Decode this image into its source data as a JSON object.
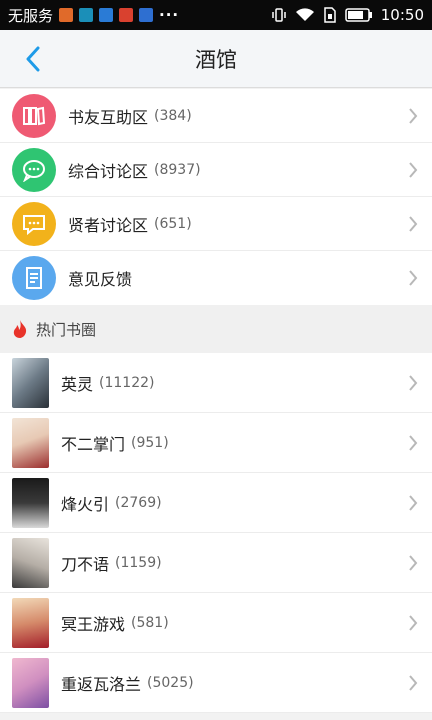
{
  "statusbar": {
    "carrier": "无服务",
    "time": "10:50",
    "more": "···",
    "app_icon_colors": [
      "#e06a2a",
      "#1b8fb8",
      "#2a7bd6",
      "#d9412f",
      "#2e6fd1"
    ]
  },
  "header": {
    "title": "酒馆",
    "back_icon": "chevron-left-icon"
  },
  "forums": [
    {
      "name": "书友互助区",
      "count": "(384)",
      "color": "#ef5a73",
      "icon": "books-icon"
    },
    {
      "name": "综合讨论区",
      "count": "(8937)",
      "color": "#2fc572",
      "icon": "chat-bubble-icon"
    },
    {
      "name": "贤者讨论区",
      "count": "(651)",
      "color": "#f2b21b",
      "icon": "message-icon"
    },
    {
      "name": "意见反馈",
      "count": "",
      "color": "#5aa8ee",
      "icon": "document-icon"
    }
  ],
  "hot_section": {
    "label": "热门书圈",
    "icon": "flame-icon"
  },
  "circles": [
    {
      "name": "英灵",
      "count": "(11122)",
      "cover_colors": [
        "#6c7a86",
        "#c9d4dc"
      ]
    },
    {
      "name": "不二掌门",
      "count": "(951)",
      "cover_colors": [
        "#e7c9b4",
        "#9b2d2d"
      ]
    },
    {
      "name": "烽火引",
      "count": "(2769)",
      "cover_colors": [
        "#1a1a1a",
        "#d9d9d9"
      ]
    },
    {
      "name": "刀不语",
      "count": "(1159)",
      "cover_colors": [
        "#e8e3dc",
        "#3a3a3a"
      ]
    },
    {
      "name": "冥王游戏",
      "count": "(581)",
      "cover_colors": [
        "#f2d9b8",
        "#a31e2a"
      ]
    },
    {
      "name": "重返瓦洛兰",
      "count": "(5025)",
      "cover_colors": [
        "#f0b8cf",
        "#7d4fa3"
      ]
    }
  ]
}
